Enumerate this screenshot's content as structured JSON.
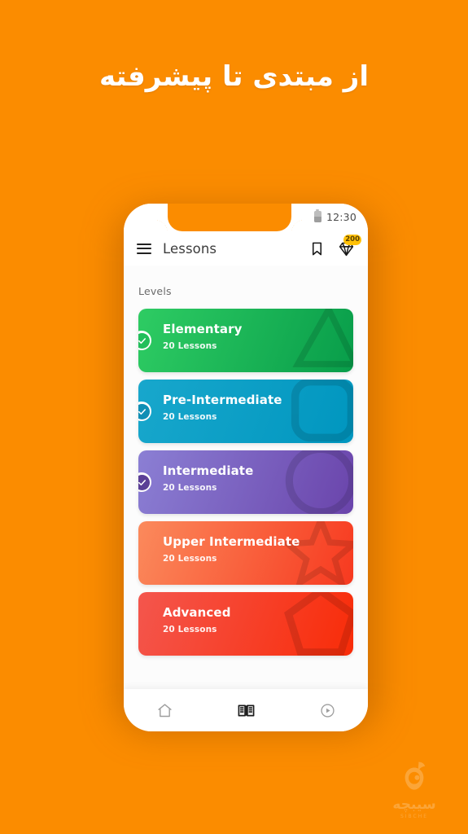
{
  "promo": {
    "headline": "از مبتدی تا پیشرفته"
  },
  "background": {
    "color": "#fb8c00"
  },
  "phone": {
    "status_bar": {
      "time": "12:30",
      "battery_icon": "battery-icon"
    },
    "app_bar": {
      "menu_icon": "hamburger-menu-icon",
      "title": "Lessons",
      "bookmark_icon": "bookmark-icon",
      "gem_icon": "diamond-gem-icon",
      "gem_count": "200",
      "gem_badge_color": "#ffc107"
    },
    "content": {
      "section_label": "Levels",
      "levels": [
        {
          "name": "Elementary",
          "lessons": "20 Lessons",
          "completed": true,
          "color_start": "#2ecc63",
          "color_end": "#089d4a",
          "check_color": "#22bf5b",
          "deco": "triangle"
        },
        {
          "name": "Pre-Intermediate",
          "lessons": "20 Lessons",
          "completed": true,
          "color_start": "#18a7cc",
          "color_end": "#0096bf",
          "check_color": "#0f8fb5",
          "deco": "rounded-square"
        },
        {
          "name": "Intermediate",
          "lessons": "20 Lessons",
          "completed": true,
          "color_start": "#8b7fd4",
          "color_end": "#6a44ab",
          "check_color": "#5b3f96",
          "deco": "circle"
        },
        {
          "name": "Upper Intermediate",
          "lessons": "20 Lessons",
          "completed": false,
          "color_start": "#fb8a5c",
          "color_end": "#f7391f",
          "check_color": "#f4603a",
          "deco": "star"
        },
        {
          "name": "Advanced",
          "lessons": "20 Lessons",
          "completed": false,
          "color_start": "#f4564d",
          "color_end": "#f92c08",
          "check_color": "#ef3b2a",
          "deco": "pentagon"
        }
      ]
    },
    "bottom_nav": [
      {
        "icon": "home-icon",
        "active": false
      },
      {
        "icon": "book-icon",
        "active": true
      },
      {
        "icon": "play-circle-icon",
        "active": false
      }
    ]
  },
  "watermark": {
    "logo_icon": "apple-logo-icon",
    "brand": "سیبچه",
    "sub": "SIBCHE"
  }
}
